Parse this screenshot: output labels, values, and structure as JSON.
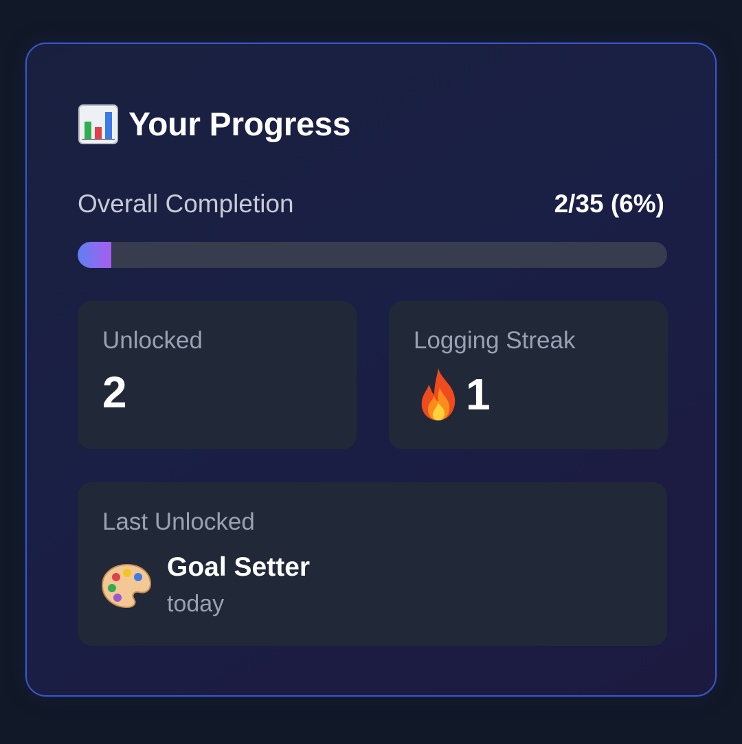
{
  "header": {
    "icon": "bar-chart-icon",
    "title": "Your Progress"
  },
  "progress": {
    "label": "Overall Completion",
    "value_text": "2/35 (6%)",
    "completed": 2,
    "total": 35,
    "percent": 6
  },
  "stats": {
    "unlocked": {
      "label": "Unlocked",
      "value": "2"
    },
    "streak": {
      "label": "Logging Streak",
      "icon": "fire-icon",
      "value": "1"
    }
  },
  "last_unlocked": {
    "label": "Last Unlocked",
    "icon": "palette-icon",
    "name": "Goal Setter",
    "time": "today"
  },
  "colors": {
    "background": "#111827",
    "card_border": "#3b55c9",
    "progress_fill_start": "#5d80f3",
    "progress_fill_end": "#a55ff0",
    "progress_track": "#373c4e",
    "tile_background": "#212838"
  }
}
